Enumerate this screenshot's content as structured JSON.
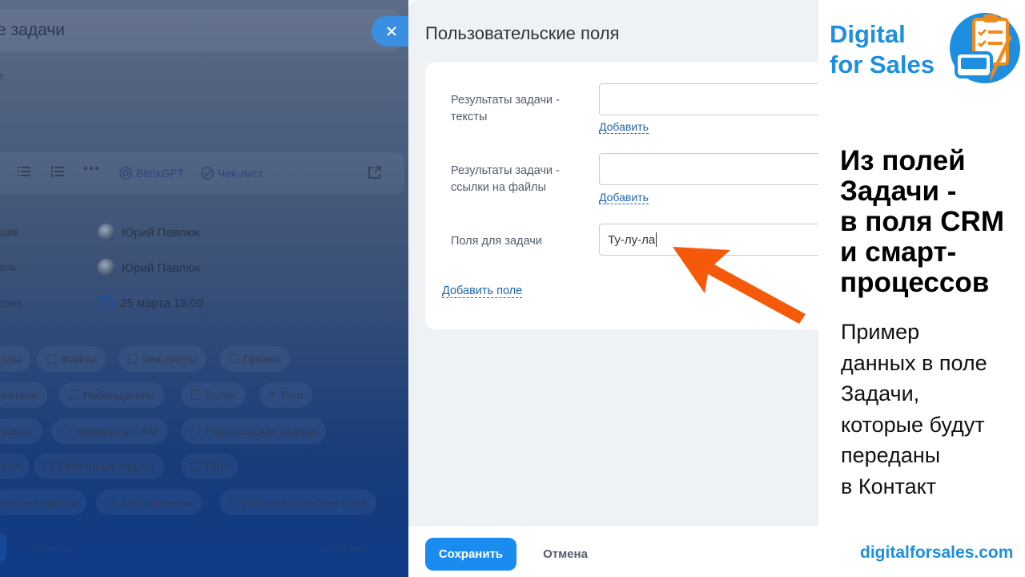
{
  "background_panel": {
    "title": "е задачи",
    "subtitle": "е",
    "toolbar": {
      "gpt_label": "BitrixGPT",
      "checklist_label": "Чек-лист"
    },
    "rows": [
      {
        "label": "щик",
        "value": "Юрий Павлюк"
      },
      {
        "label": "ель",
        "value": "Юрий Павлюк"
      },
      {
        "label": "срок",
        "value": "25 марта 19:00"
      }
    ],
    "chips": [
      "аты",
      "Файлы",
      "Чек-листы",
      "Проект",
      "нители",
      "Наблюдатели",
      "Поток",
      "Теги",
      "нания",
      "Элементы CRM",
      "Родительская задача",
      "ния",
      "Связанные задачи",
      "Гант",
      "ование сроков",
      "Учёт времени",
      "Пользовательские поля"
    ],
    "bottom_left": "Отмена",
    "bottom_right": "найдено"
  },
  "modal": {
    "title": "Пользовательские поля",
    "close_icon": "close-icon",
    "fields": [
      {
        "label": "Результаты задачи - тексты",
        "value": "",
        "link": "Добавить"
      },
      {
        "label": "Результаты задачи - ссылки на файлы",
        "value": "",
        "link": "Добавить"
      },
      {
        "label": "Поля для задачи",
        "value": "Ту-лу-ла"
      }
    ],
    "add_field": "Добавить поле",
    "save_label": "Сохранить",
    "cancel_label": "Отмена"
  },
  "branding": {
    "brand_line1": "Digital",
    "brand_line2": "for Sales",
    "headline": [
      "Из полей",
      "Задачи -",
      "в поля CRM",
      "и смарт-",
      "процессов"
    ],
    "description": [
      "Пример",
      "данных в поле",
      "Задачи,",
      "которые будут",
      "переданы",
      "в Контакт"
    ],
    "website": "digitalforsales.com"
  },
  "colors": {
    "accent": "#1e8fe0",
    "arrow": "#f55a0a",
    "save_button": "#1a8cf0",
    "link": "#2067b0"
  }
}
